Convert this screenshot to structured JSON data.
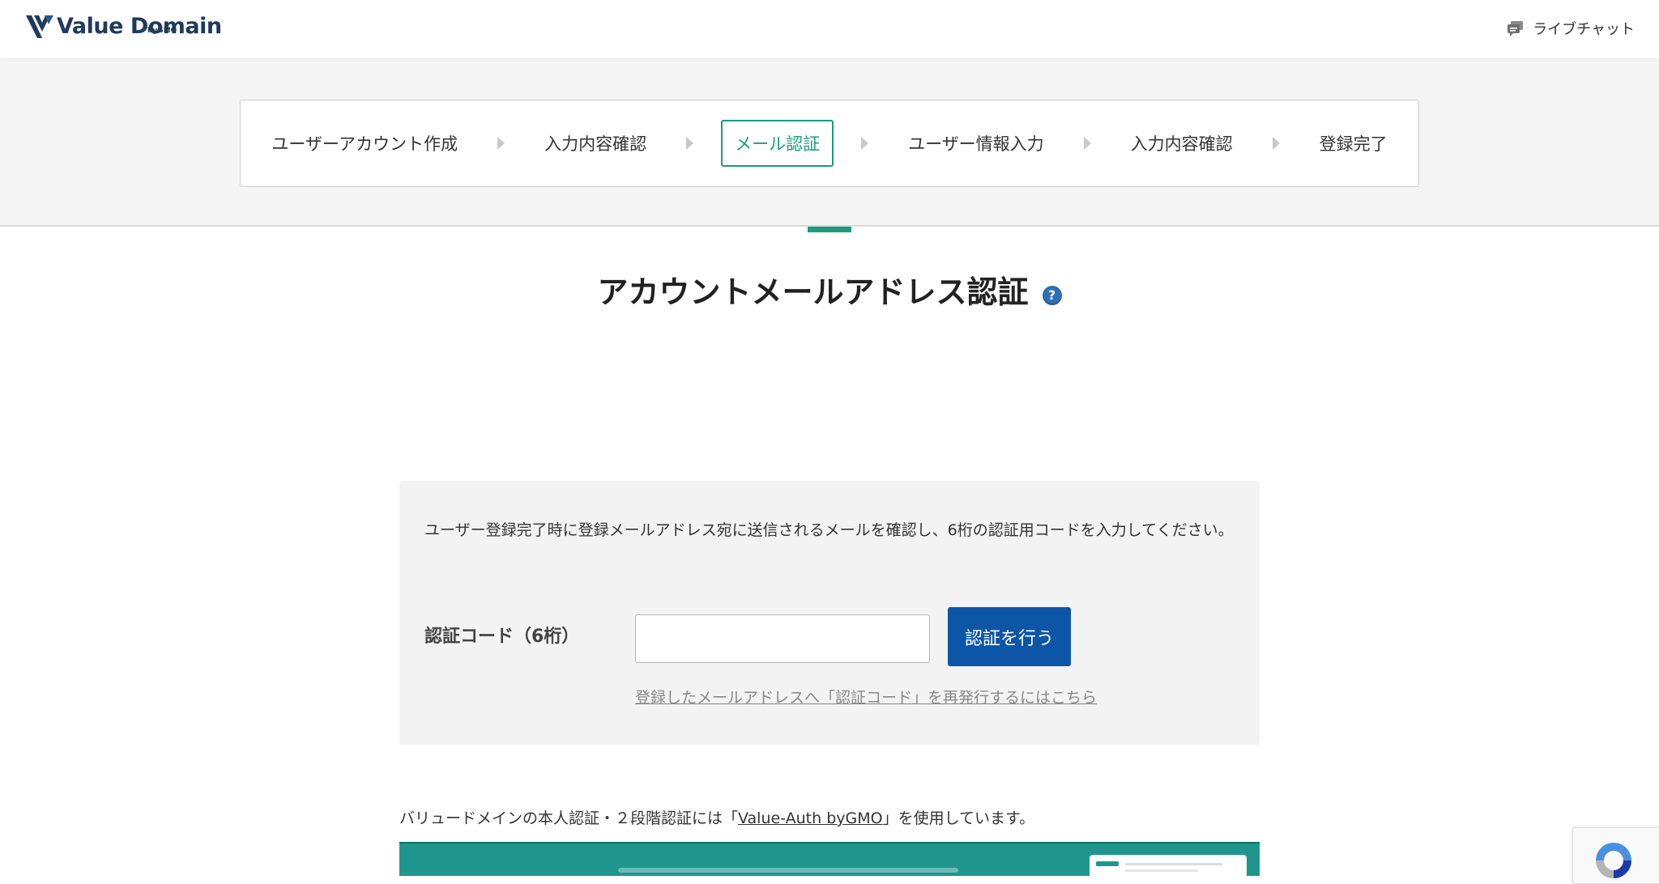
{
  "header": {
    "logo_text": "Value Domain",
    "logo_sub": "byGMO",
    "chat_label": "ライブチャット"
  },
  "stepper": {
    "steps": [
      {
        "label": "ユーザーアカウント作成",
        "active": false
      },
      {
        "label": "入力内容確認",
        "active": false
      },
      {
        "label": "メール認証",
        "active": true
      },
      {
        "label": "ユーザー情報入力",
        "active": false
      },
      {
        "label": "入力内容確認",
        "active": false
      },
      {
        "label": "登録完了",
        "active": false
      }
    ]
  },
  "page": {
    "title": "アカウントメールアドレス認証",
    "help_glyph": "?"
  },
  "form": {
    "description": "ユーザー登録完了時に登録メールアドレス宛に送信されるメールを確認し、6桁の認証用コードを入力してください。",
    "code_label": "認証コード（6桁）",
    "code_value": "",
    "submit_label": "認証を行う",
    "resend_link": "登録したメールアドレスへ「認証コード」を再発行するにはこちら"
  },
  "footer_note": {
    "prefix": "バリュードメインの本人認証・２段階認証には「",
    "link": "Value-Auth byGMO",
    "suffix": "」を使用しています。"
  },
  "colors": {
    "accent": "#1a9b7c",
    "primary_button": "#0d55a6",
    "banner": "#1f968d"
  },
  "icons": {
    "chat": "chat-bubble-icon",
    "help": "question-circle-icon",
    "logo": "value-domain-logo-icon",
    "recaptcha": "recaptcha-icon"
  }
}
